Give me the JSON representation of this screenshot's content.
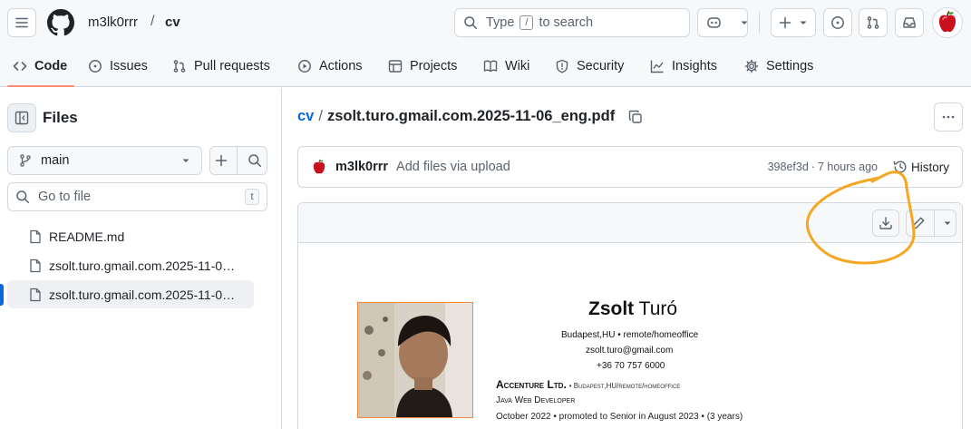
{
  "header": {
    "owner": "m3lk0rrr",
    "separator": "/",
    "repo": "cv",
    "search_placeholder_before": "Type",
    "search_key": "/",
    "search_placeholder_after": "to search"
  },
  "repo_nav": {
    "tabs": [
      {
        "label": "Code",
        "icon": "code-icon",
        "active": true
      },
      {
        "label": "Issues",
        "icon": "issue-icon"
      },
      {
        "label": "Pull requests",
        "icon": "pull-request-icon"
      },
      {
        "label": "Actions",
        "icon": "play-icon"
      },
      {
        "label": "Projects",
        "icon": "table-icon"
      },
      {
        "label": "Wiki",
        "icon": "book-icon"
      },
      {
        "label": "Security",
        "icon": "shield-icon"
      },
      {
        "label": "Insights",
        "icon": "graph-icon"
      },
      {
        "label": "Settings",
        "icon": "gear-icon"
      }
    ]
  },
  "sidebar": {
    "title": "Files",
    "branch": "main",
    "filter_placeholder": "Go to file",
    "filter_shortcut": "t",
    "files": [
      {
        "name": "README.md",
        "selected": false
      },
      {
        "name": "zsolt.turo.gmail.com.2025-11-0…",
        "selected": false
      },
      {
        "name": "zsolt.turo.gmail.com.2025-11-0…",
        "selected": true
      }
    ]
  },
  "file": {
    "repo_link": "cv",
    "separator": "/",
    "filename": "zsolt.turo.gmail.com.2025-11-06_eng.pdf"
  },
  "commit": {
    "author": "m3lk0rrr",
    "message": "Add files via upload",
    "sha": "398ef3d",
    "dot": "·",
    "time": "7 hours ago",
    "history_label": "History"
  },
  "cv": {
    "first_name": "Zsolt",
    "last_name": "Turó",
    "location": "Budapest,HU • remote/homeoffice",
    "email": "zsolt.turo@gmail.com",
    "phone": "+36 70 757 6000",
    "company": "Accenture Ltd.",
    "company_location": "• Budapest,HU/remote/homeoffice",
    "role": "Java Web Developer",
    "period": "October 2022 • promoted to Senior in August 2023 • (3 years)"
  },
  "colors": {
    "accent_underline": "#fd8c73",
    "annotation": "#f5a623",
    "link": "#0969da",
    "selected_marker": "#0969da"
  }
}
